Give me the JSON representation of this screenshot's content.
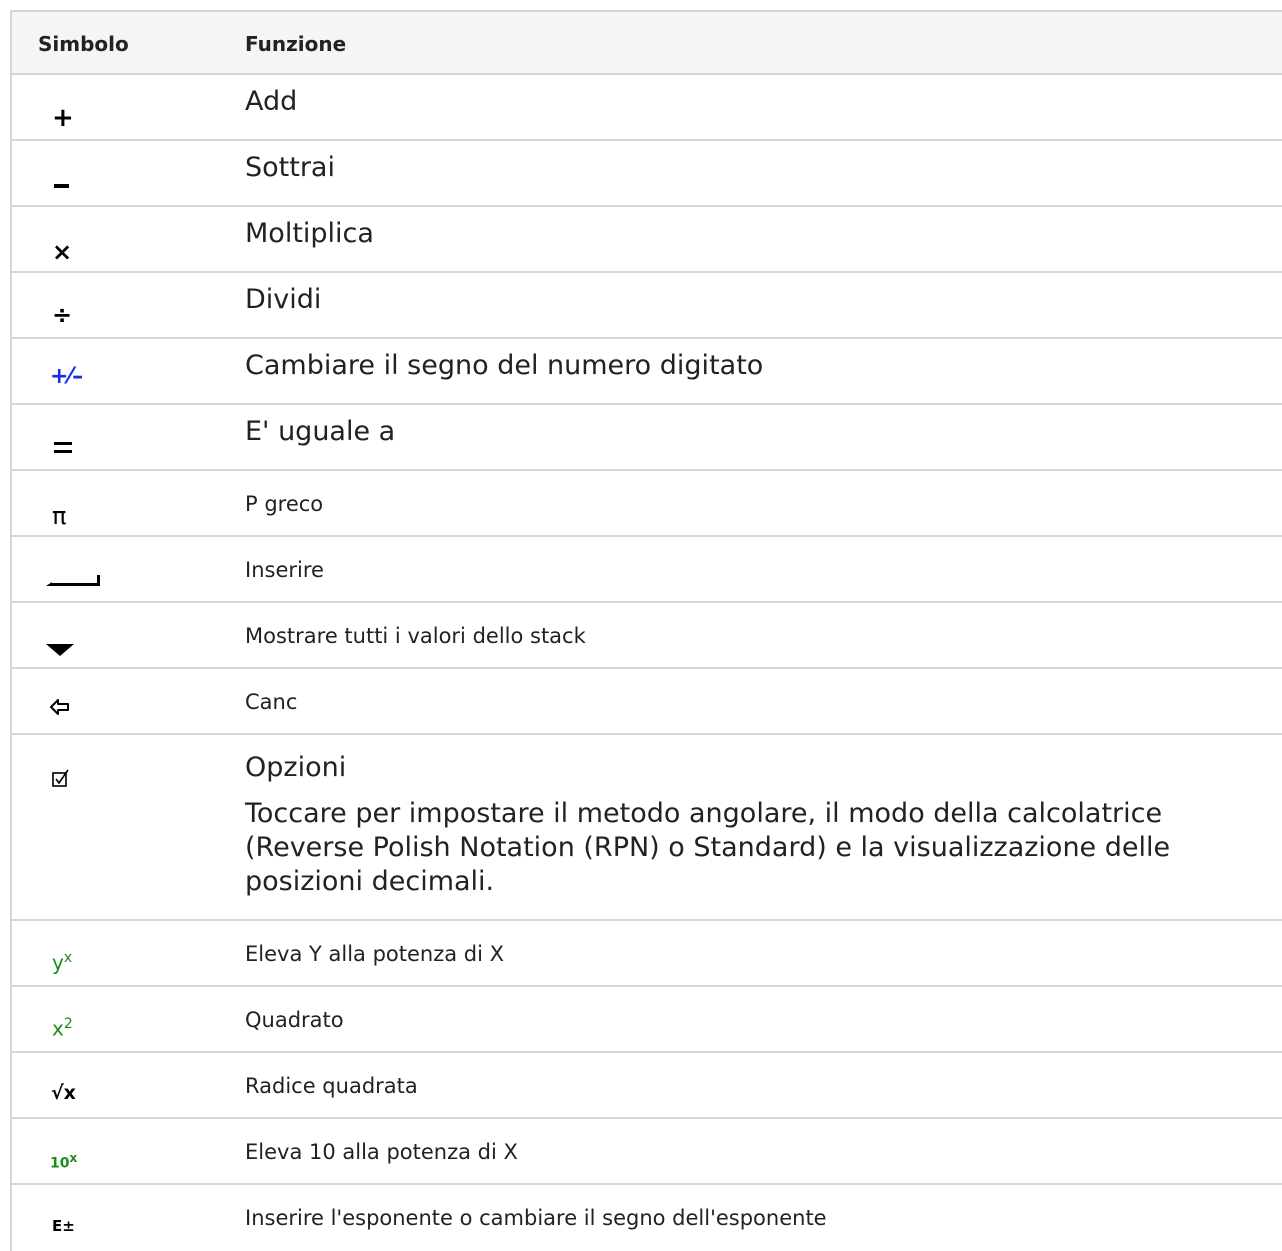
{
  "header": {
    "symbol": "Simbolo",
    "function": "Funzione"
  },
  "rows": [
    {
      "icon": "plus-icon",
      "symbol": "+",
      "function": "Add"
    },
    {
      "icon": "minus-icon",
      "symbol": "–",
      "function": "Sottrai"
    },
    {
      "icon": "multiply-icon",
      "symbol": "×",
      "function": "Moltiplica"
    },
    {
      "icon": "divide-icon",
      "symbol": "÷",
      "function": "Dividi"
    },
    {
      "icon": "plus-minus-icon",
      "symbol": "+⁄–",
      "function": "Cambiare il segno del numero digitato"
    },
    {
      "icon": "equals-icon",
      "symbol": "=",
      "function": "E' uguale a"
    },
    {
      "icon": "pi-icon",
      "symbol": "π",
      "function": "P greco"
    },
    {
      "icon": "enter-icon",
      "symbol": "",
      "function": "Inserire"
    },
    {
      "icon": "triangle-down-icon",
      "symbol": "",
      "function": "Mostrare tutti i valori dello stack"
    },
    {
      "icon": "backspace-icon",
      "symbol": "⇦",
      "function": "Canc"
    },
    {
      "icon": "checkbox-icon",
      "symbol": "☑",
      "function": "Opzioni",
      "description": "Toccare per impostare il metodo angolare, il modo della calcolatrice (Reverse Polish Notation (RPN) o Standard) e la visualizzazione delle posizioni decimali."
    },
    {
      "icon": "y-power-x-icon",
      "symbol_base": "y",
      "symbol_sup": "x",
      "function": "Eleva Y alla potenza di X"
    },
    {
      "icon": "x-squared-icon",
      "symbol_base": "x",
      "symbol_sup": "2",
      "function": "Quadrato"
    },
    {
      "icon": "square-root-icon",
      "symbol": "√x",
      "function": "Radice quadrata"
    },
    {
      "icon": "ten-power-x-icon",
      "symbol_base": "10",
      "symbol_sup": "x",
      "function": "Eleva 10 alla potenza di X"
    },
    {
      "icon": "exponent-icon",
      "symbol": "E±",
      "function": "Inserire l'esponente o cambiare il segno dell'esponente"
    }
  ],
  "colors": {
    "border": "#d6d6d6",
    "header_bg": "#f5f5f5",
    "green": "#1a8c1a",
    "blue": "#1a2ee8"
  }
}
